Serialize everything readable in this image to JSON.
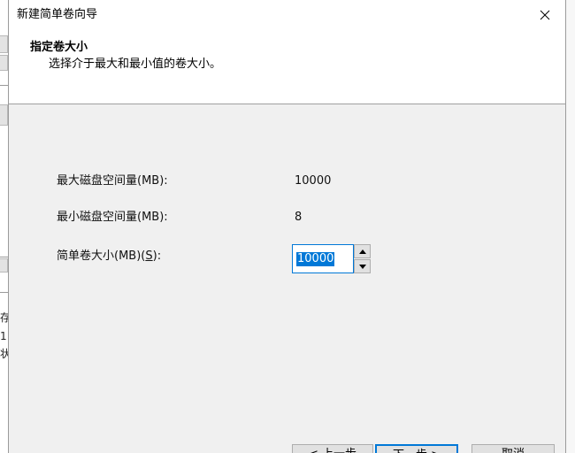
{
  "window": {
    "title": "新建简单卷向导",
    "close_label": "✕"
  },
  "header": {
    "title": "指定卷大小",
    "subtitle": "选择介于最大和最小值的卷大小。"
  },
  "fields": {
    "max_label": "最大磁盘空间量(MB):",
    "max_value": "10000",
    "min_label": "最小磁盘空间量(MB):",
    "min_value": "8",
    "size_label_prefix": "简单卷大小(MB)(",
    "size_label_accel": "S",
    "size_label_suffix": "):",
    "size_value": "10000"
  },
  "buttons": {
    "back": "< 上一步",
    "next": "下一步 >",
    "cancel": "取消"
  },
  "background": {
    "frag1": "存",
    "frag2": "1",
    "frag3": "状"
  },
  "colors": {
    "accent": "#0078d7"
  }
}
